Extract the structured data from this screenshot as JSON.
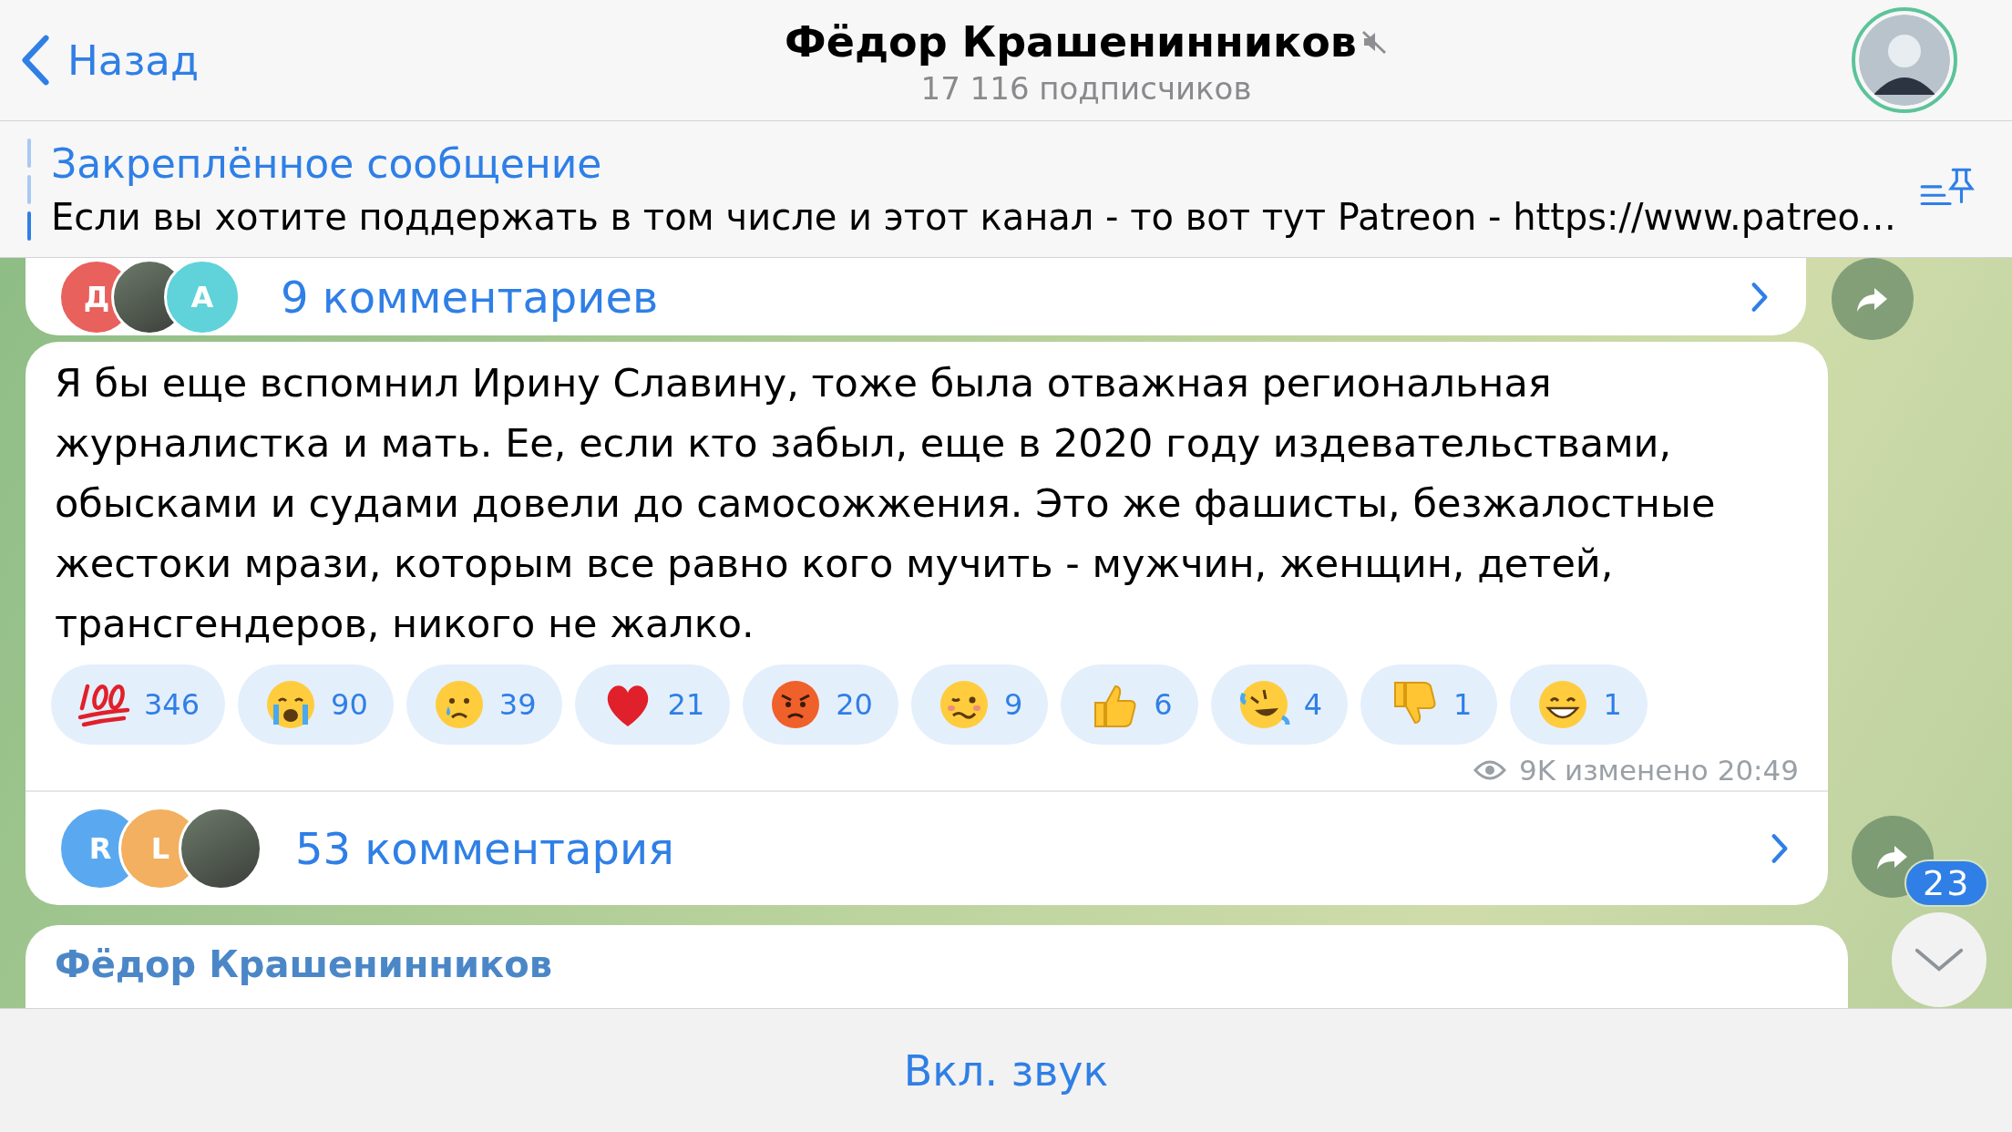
{
  "header": {
    "back_label": "Назад",
    "title": "Фёдор Крашенинников",
    "muted": true,
    "subtitle": "17 116 подписчиков"
  },
  "pinned": {
    "title": "Закреплённое сообщение",
    "text": "Если вы хотите поддержать в том числе и этот канал - то вот тут Patreon - https://www.patreo…"
  },
  "previous_post": {
    "comments": {
      "label": "9 комментариев",
      "avatars": [
        {
          "kind": "letter",
          "letter": "Д",
          "color": "#e8615c"
        },
        {
          "kind": "photo"
        },
        {
          "kind": "letter",
          "letter": "А",
          "color": "#5fd3d9"
        }
      ]
    }
  },
  "post": {
    "text": "Я бы еще вспомнил Ирину Славину, тоже была отважная региональная журналистка и мать. Ее, если кто забыл, еще в 2020 году издевательствами, обысками и судами довели до самосожжения. Это же фашисты, безжалостные жестоки мрази, которым все равно кого мучить - мужчин, женщин, детей, трансгендеров, никого не жалко.",
    "reactions": [
      {
        "kind": "hundred",
        "count": "346"
      },
      {
        "kind": "crying",
        "count": "90"
      },
      {
        "kind": "sad",
        "count": "39"
      },
      {
        "kind": "heart",
        "count": "21"
      },
      {
        "kind": "angry",
        "count": "20"
      },
      {
        "kind": "woozy",
        "count": "9"
      },
      {
        "kind": "thumbs_up",
        "count": "6"
      },
      {
        "kind": "rofl",
        "count": "4"
      },
      {
        "kind": "thumbs_down",
        "count": "1"
      },
      {
        "kind": "grin",
        "count": "1"
      }
    ],
    "views": "9K",
    "edited": "изменено",
    "time": "20:49",
    "comments": {
      "label": "53 комментария",
      "avatars": [
        {
          "kind": "letter",
          "letter": "R",
          "color": "#5aa9f0"
        },
        {
          "kind": "letter",
          "letter": "L",
          "color": "#f2b060"
        },
        {
          "kind": "photo"
        }
      ]
    }
  },
  "next_post": {
    "author": "Фёдор Крашенинников"
  },
  "unread_count": "23",
  "bottom_bar": {
    "label": "Вкл. звук"
  }
}
